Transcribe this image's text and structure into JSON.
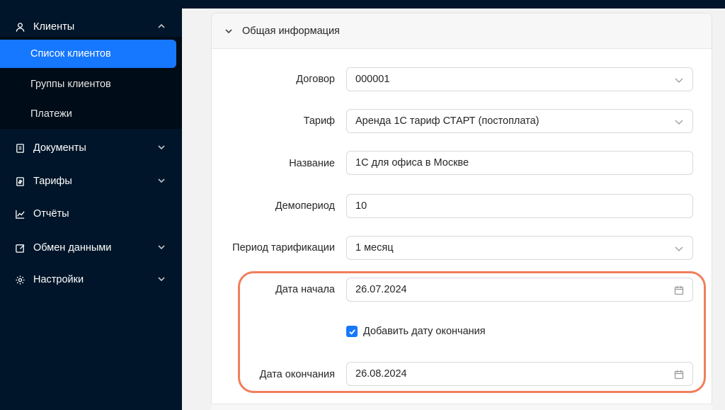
{
  "sidebar": {
    "clients": {
      "label": "Клиенты",
      "icon": "user-icon"
    },
    "submenu": [
      {
        "label": "Список клиентов",
        "active": true
      },
      {
        "label": "Группы клиентов",
        "active": false
      },
      {
        "label": "Платежи",
        "active": false
      }
    ],
    "documents": {
      "label": "Документы",
      "icon": "document-icon"
    },
    "tariffs": {
      "label": "Тарифы",
      "icon": "tariff-icon"
    },
    "reports": {
      "label": "Отчёты",
      "icon": "chart-line-icon"
    },
    "exchange": {
      "label": "Обмен данными",
      "icon": "edit-square-icon"
    },
    "settings": {
      "label": "Настройки",
      "icon": "gear-icon"
    }
  },
  "panel": {
    "title": "Общая информация",
    "fields": {
      "contract": {
        "label": "Договор",
        "value": "000001"
      },
      "tariff": {
        "label": "Тариф",
        "value": "Аренда 1С тариф СТАРТ (постоплата)"
      },
      "name": {
        "label": "Название",
        "value": "1С для офиса в Москве"
      },
      "demo": {
        "label": "Демопериод",
        "value": "10"
      },
      "billing": {
        "label": "Период тарификации",
        "value": "1 месяц"
      },
      "start_date": {
        "label": "Дата начала",
        "value": "26.07.2024"
      },
      "end_date_checkbox": {
        "label": "Добавить дату окончания",
        "checked": true
      },
      "end_date": {
        "label": "Дата окончания",
        "value": "26.08.2024"
      }
    }
  },
  "colors": {
    "accent": "#1677ff",
    "sidebar": "#001529",
    "highlight": "#f07f5c"
  }
}
